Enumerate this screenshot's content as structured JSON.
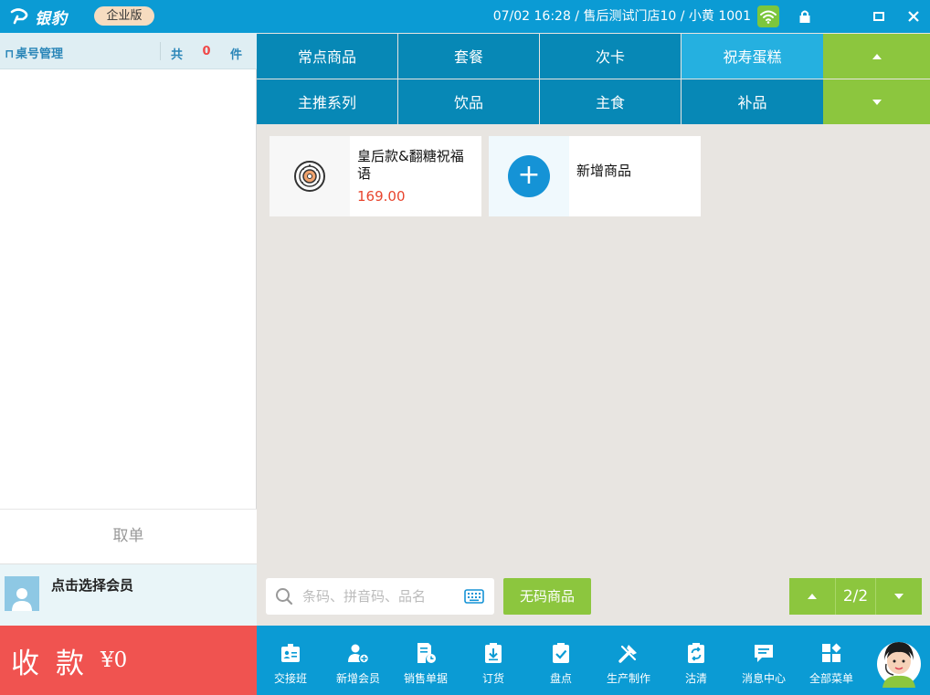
{
  "app": {
    "logo_text": "银豹",
    "edition": "企业版",
    "status": "07/02 16:28 / 售后测试门店10 / 小黄 1001"
  },
  "left": {
    "table_title": "桌号管理",
    "count_prefix": "共",
    "count": "0",
    "count_unit": "件",
    "cancel_label": "取单",
    "member_label": "点击选择会员"
  },
  "categories": {
    "row1": [
      "常点商品",
      "套餐",
      "次卡",
      "祝寿蛋糕"
    ],
    "row2": [
      "主推系列",
      "饮品",
      "主食",
      "补品"
    ],
    "active": "祝寿蛋糕"
  },
  "products": [
    {
      "name": "皇后款&翻糖祝福语",
      "price": "169.00"
    }
  ],
  "add_product_label": "新增商品",
  "search": {
    "placeholder": "条码、拼音码、品名"
  },
  "no_code_label": "无码商品",
  "pager": {
    "page": "2/2"
  },
  "pay": {
    "label": "收款",
    "amount": "¥0"
  },
  "toolbar": [
    {
      "label": "交接班",
      "icon": "handover-icon"
    },
    {
      "label": "新增会员",
      "icon": "add-member-icon"
    },
    {
      "label": "销售单据",
      "icon": "sales-record-icon"
    },
    {
      "label": "订货",
      "icon": "order-goods-icon"
    },
    {
      "label": "盘点",
      "icon": "inventory-check-icon"
    },
    {
      "label": "生产制作",
      "icon": "production-icon"
    },
    {
      "label": "沽清",
      "icon": "sold-out-icon"
    },
    {
      "label": "消息中心",
      "icon": "message-icon"
    },
    {
      "label": "全部菜单",
      "icon": "all-menu-icon"
    }
  ],
  "colors": {
    "titlebar": "#0b9bd4",
    "category": "#0788b6",
    "category_active": "#25b0e0",
    "accent_green": "#8cc63e",
    "pay_red": "#f05350",
    "price_red": "#e8452e"
  }
}
